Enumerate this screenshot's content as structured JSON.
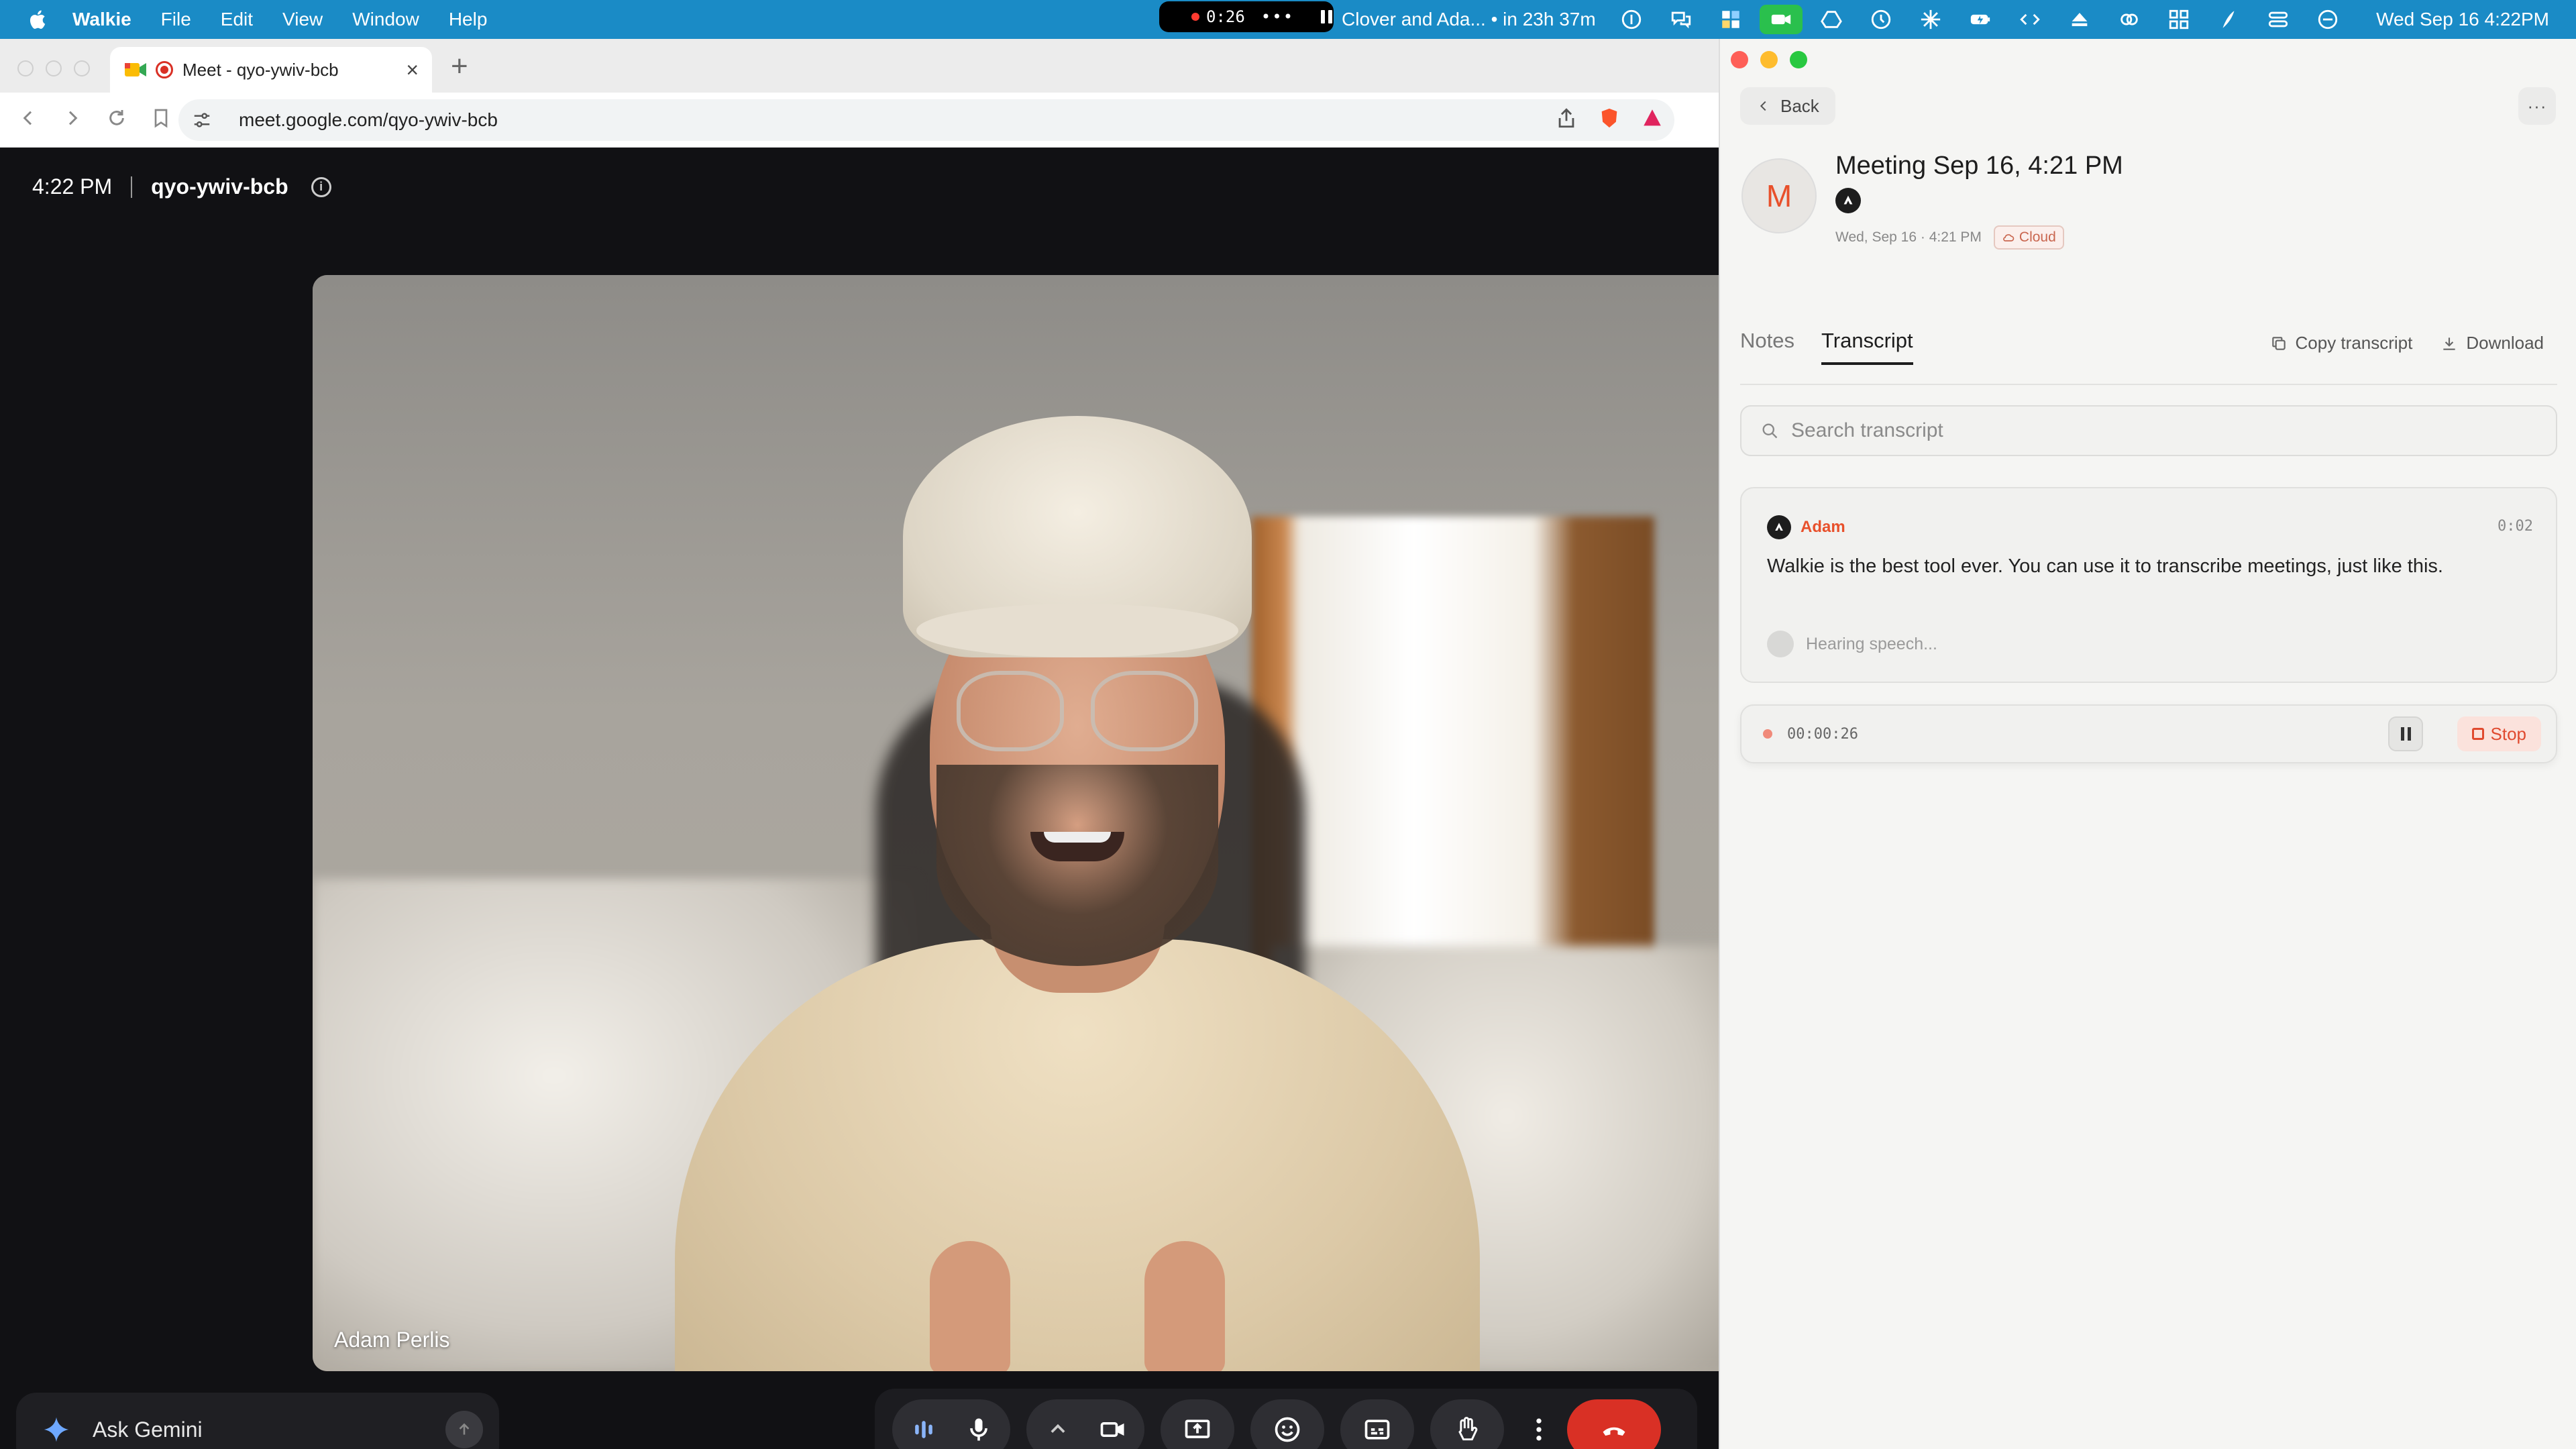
{
  "menubar": {
    "app_name": "Walkie",
    "menus": [
      "File",
      "Edit",
      "View",
      "Window",
      "Help"
    ],
    "recording_time": "0:26",
    "recording_more": "•••",
    "event": "Clover and Ada... • in 23h 37m",
    "clock": "Wed Sep 16  4:22PM"
  },
  "browser": {
    "tab_title": "Meet - qyo-ywiv-bcb",
    "tab_close": "×",
    "new_tab": "+",
    "url": "meet.google.com/qyo-ywiv-bcb"
  },
  "meet": {
    "time": "4:22 PM",
    "meeting_code": "qyo-ywiv-bcb",
    "info_glyph": "i",
    "participant_name": "Adam Perlis",
    "ask_gemini": "Ask Gemini"
  },
  "walkie": {
    "back_label": "Back",
    "more_label": "···",
    "avatar_letter": "M",
    "meeting_title": "Meeting Sep 16, 4:21 PM",
    "meeting_meta": "Wed, Sep 16 · 4:21 PM",
    "cloud_label": "Cloud",
    "tabs": [
      {
        "label": "Notes",
        "active": false
      },
      {
        "label": "Transcript",
        "active": true
      }
    ],
    "copy_transcript": "Copy transcript",
    "download": "Download",
    "search_placeholder": "Search transcript",
    "entries": [
      {
        "speaker": "Adam",
        "timestamp": "0:02",
        "text": "Walkie is the best tool ever. You can use it to transcribe meetings, just like this."
      }
    ],
    "hearing_status": "Hearing speech...",
    "elapsed": "00:00:26",
    "stop_label": "Stop",
    "accent_color": "#e8502b"
  }
}
